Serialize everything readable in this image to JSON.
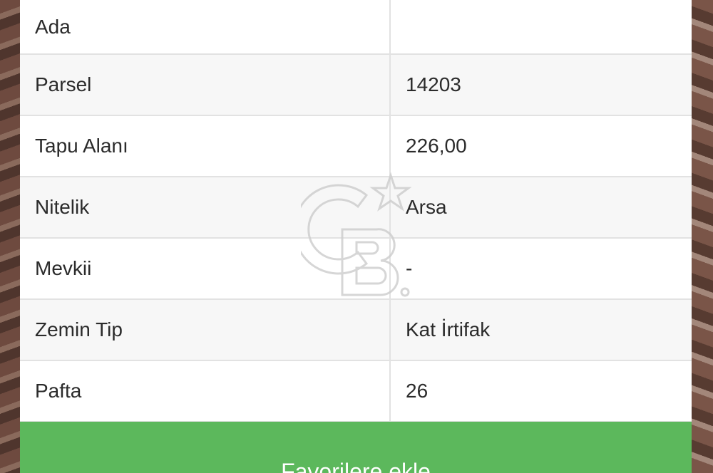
{
  "details": {
    "rows": [
      {
        "label": "Ada",
        "value": ""
      },
      {
        "label": "Parsel",
        "value": "14203"
      },
      {
        "label": "Tapu Alanı",
        "value": "226,00"
      },
      {
        "label": "Nitelik",
        "value": "Arsa"
      },
      {
        "label": "Mevkii",
        "value": "-"
      },
      {
        "label": "Zemin Tip",
        "value": "Kat İrtifak"
      },
      {
        "label": "Pafta",
        "value": "26"
      }
    ]
  },
  "actions": {
    "favorite_label": "Favorilere ekle"
  },
  "watermark": {
    "logo_text": "CB",
    "icon": "cb-star-logo-icon"
  },
  "colors": {
    "button_green": "#5cb85c",
    "row_alt": "#f7f7f7",
    "border": "#e2e2e2"
  }
}
